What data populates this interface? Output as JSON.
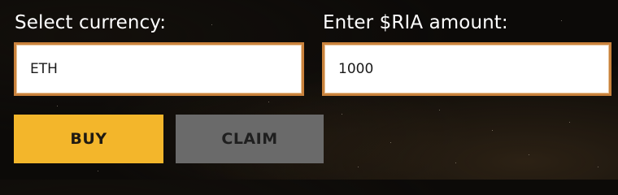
{
  "form": {
    "currency_label": "Select currency:",
    "currency_value": "ETH",
    "amount_label": "Enter $RIA amount:",
    "amount_value": "1000"
  },
  "actions": {
    "buy_label": "BUY",
    "claim_label": "CLAIM"
  },
  "colors": {
    "buy_button": "#f3b62b",
    "claim_button": "#6a6a6a",
    "field_border": "#c9823c",
    "background": "#0c0a08"
  }
}
